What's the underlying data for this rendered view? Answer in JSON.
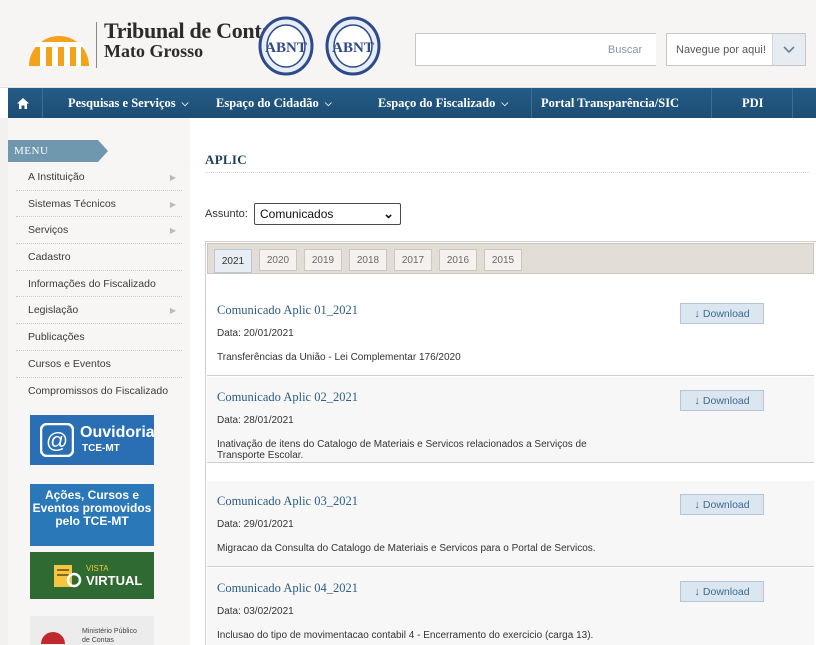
{
  "header": {
    "org_line1": "Tribunal de Contas",
    "org_line2": "Mato Grosso",
    "seal_text": "ABNT",
    "search": {
      "placeholder": "",
      "button_label": "Buscar"
    },
    "quick_nav": {
      "label": "Navegue por aqui!"
    }
  },
  "navbar": {
    "items": [
      {
        "label": "Pesquisas e Serviços",
        "has_dropdown": true
      },
      {
        "label": "Espaço do Cidadão",
        "has_dropdown": true
      },
      {
        "label": "Espaço do Fiscalizado",
        "has_dropdown": true
      },
      {
        "label": "Portal Transparência/SIC",
        "has_dropdown": false
      },
      {
        "label": "PDI",
        "has_dropdown": false
      }
    ],
    "home_icon": "home-icon"
  },
  "sidebar": {
    "menu_title": "MENU",
    "items": [
      {
        "label": "A Instituição",
        "has_arrow": true
      },
      {
        "label": "Sistemas Técnicos",
        "has_arrow": true
      },
      {
        "label": "Serviços",
        "has_arrow": true
      },
      {
        "label": "Cadastro",
        "has_arrow": false
      },
      {
        "label": "Informações do Fiscalizado",
        "has_arrow": false
      },
      {
        "label": "Legislação",
        "has_arrow": true
      },
      {
        "label": "Publicações",
        "has_arrow": false
      },
      {
        "label": "Cursos e Eventos",
        "has_arrow": false
      },
      {
        "label": "Compromissos do Fiscalizado",
        "has_arrow": false
      }
    ],
    "banners": {
      "ouvidoria": {
        "line1": "Ouvidoria",
        "line2": "TCE-MT"
      },
      "acoes": "Ações, Cursos e Eventos promovidos pelo TCE-MT",
      "vista": {
        "line1": "VISTA",
        "line2": "VIRTUAL"
      },
      "mpc": {
        "line1": "Ministério Público",
        "line2": "de Contas"
      }
    }
  },
  "main": {
    "title": "APLIC",
    "assunto_label": "Assunto:",
    "assunto_value": "Comunicados",
    "tabs": [
      "2021",
      "2020",
      "2019",
      "2018",
      "2017",
      "2016",
      "2015"
    ],
    "active_tab": "2021",
    "download_label": "Download",
    "items": [
      {
        "title": "Comunicado Aplic 01_2021",
        "date": "Data: 20/01/2021",
        "description": "Transferências da União - Lei Complementar 176/2020"
      },
      {
        "title": "Comunicado Aplic 02_2021",
        "date": "Data: 28/01/2021",
        "description": "Inativação de itens do Catalogo de Materiais e Servicos relacionados a Serviços de Transporte Escolar."
      },
      {
        "title": "Comunicado Aplic 03_2021",
        "date": "Data: 29/01/2021",
        "description": "Migracao da Consulta do Catalogo de Materiais e Servicos para o Portal de Servicos."
      },
      {
        "title": "Comunicado Aplic 04_2021",
        "date": "Data: 03/02/2021",
        "description": "Inclusao do tipo de movimentacao contabil 4 - Encerramento do exercicio (carga 13)."
      }
    ]
  },
  "colors": {
    "navbar": "#1f5580",
    "accent_title": "#2d5d83",
    "menu_tab": "#6f97ad",
    "logo_orange": "#f2a21b"
  }
}
